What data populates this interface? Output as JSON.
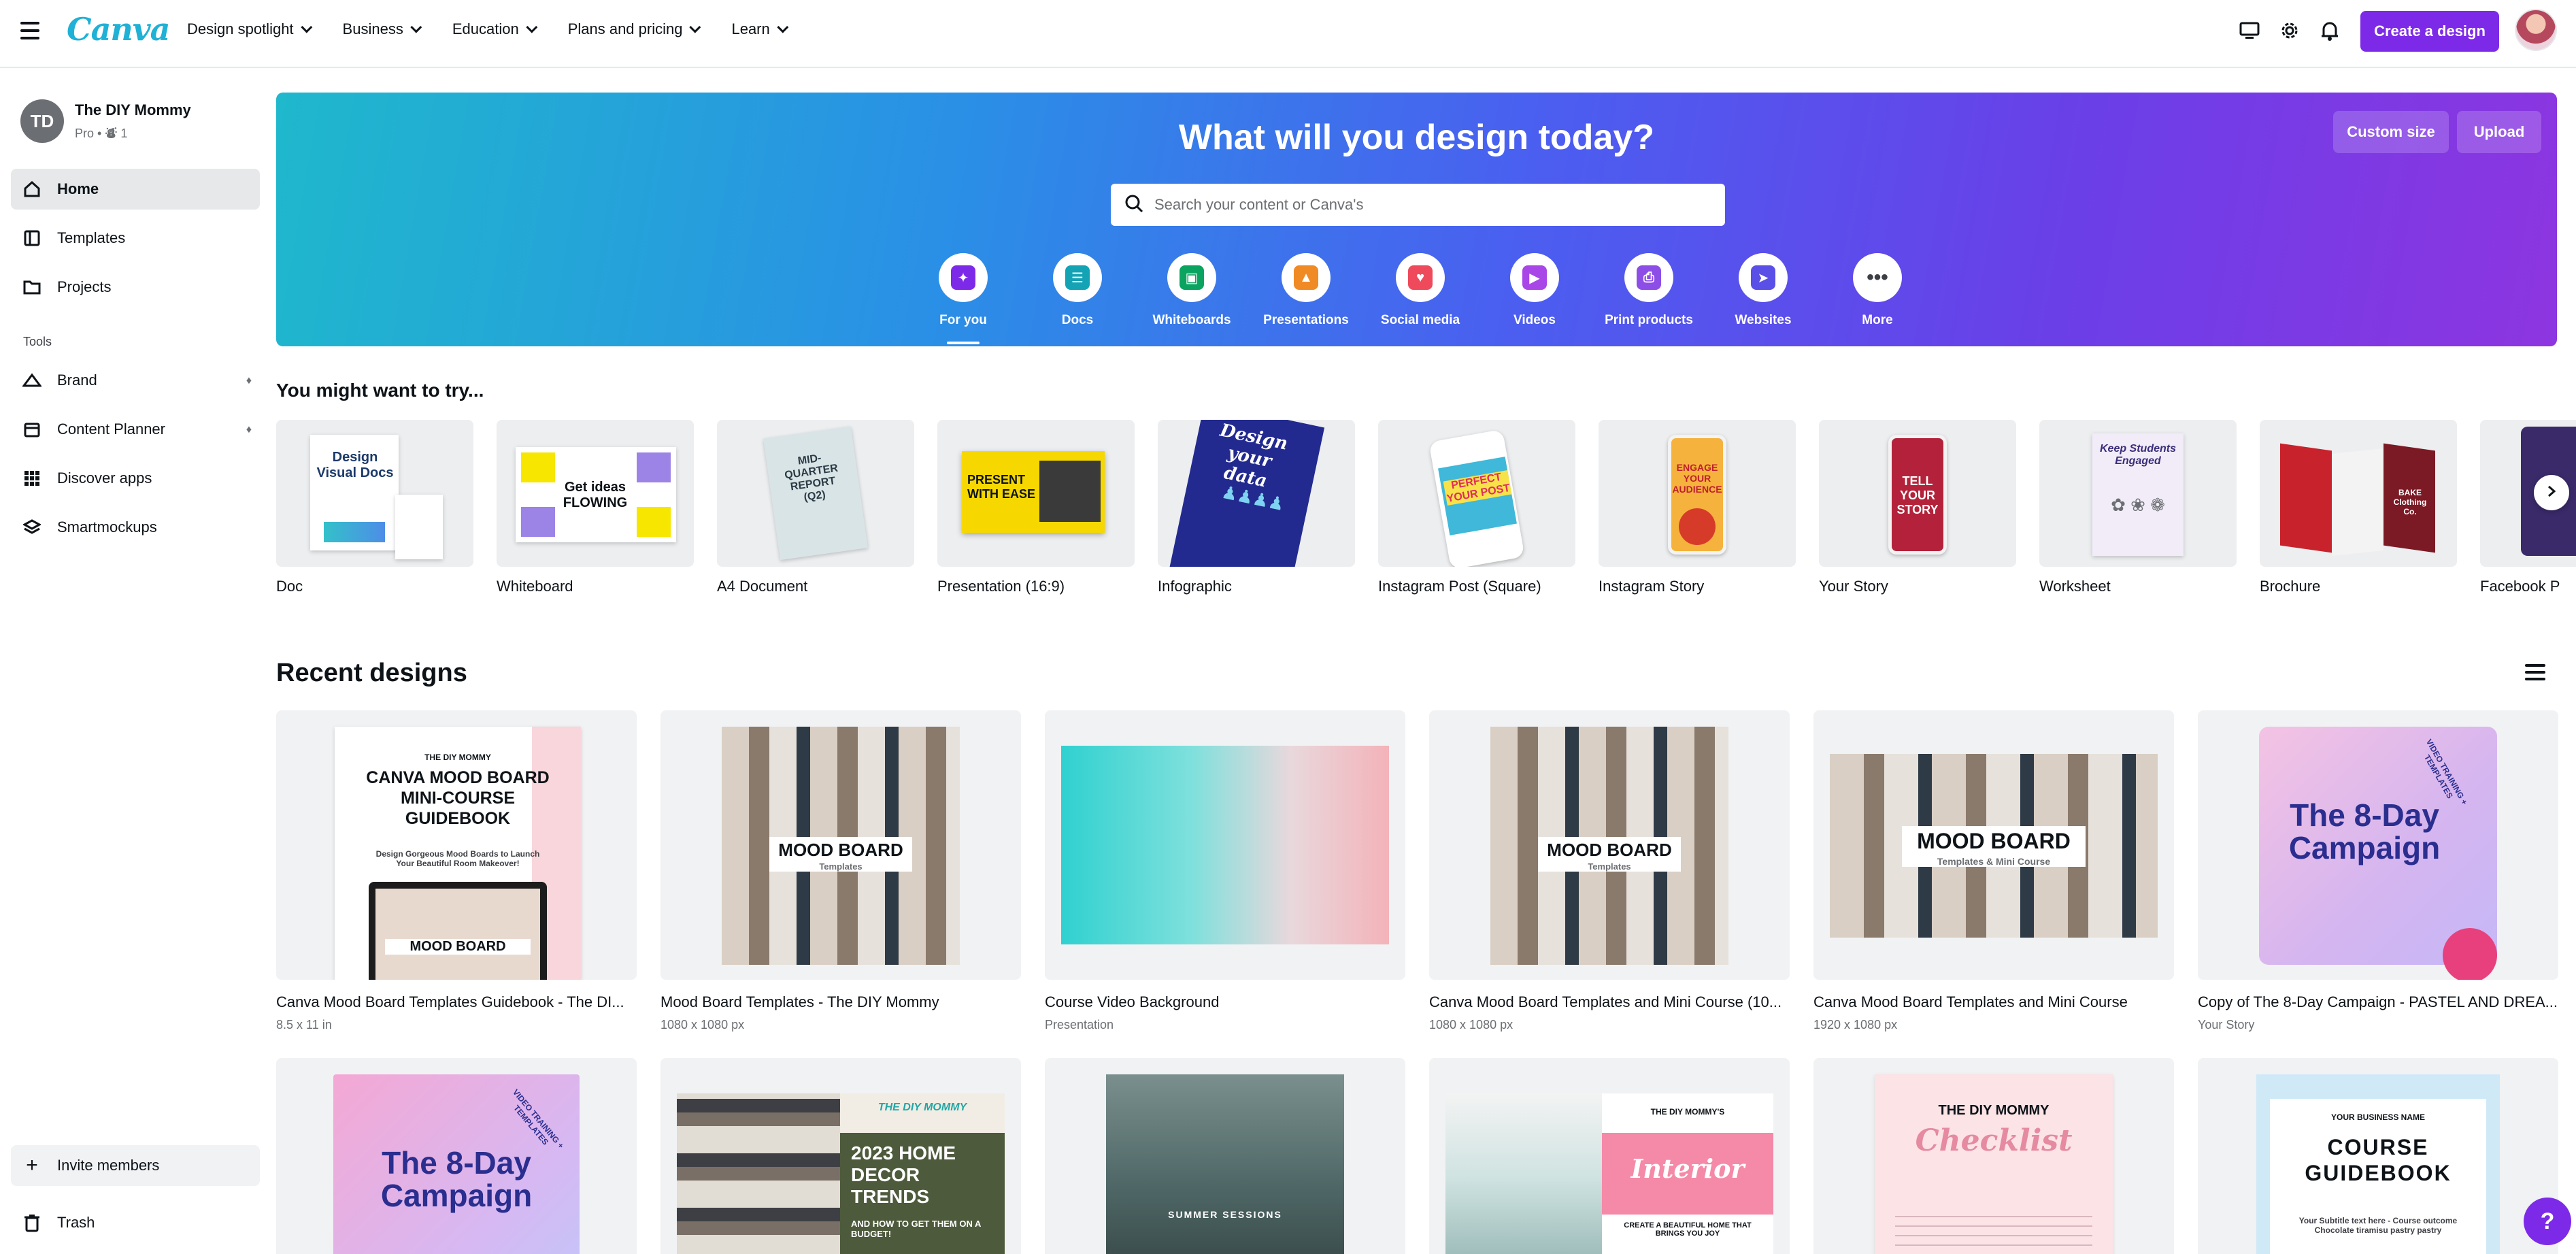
{
  "topbar": {
    "logo": "Canva",
    "nav": [
      "Design spotlight",
      "Business",
      "Education",
      "Plans and pricing",
      "Learn"
    ],
    "create_button": "Create a design"
  },
  "sidebar": {
    "team_initials": "TD",
    "team_name": "The DIY Mommy",
    "team_sub": "Pro • ⛇ 1",
    "items": [
      "Home",
      "Templates",
      "Projects"
    ],
    "tools_label": "Tools",
    "tools": [
      "Brand",
      "Content Planner",
      "Discover apps",
      "Smartmockups"
    ],
    "invite": "Invite members",
    "trash": "Trash"
  },
  "hero": {
    "title": "What will you design today?",
    "custom_size": "Custom size",
    "upload": "Upload",
    "search_placeholder": "Search your content or Canva's",
    "categories": [
      "For you",
      "Docs",
      "Whiteboards",
      "Presentations",
      "Social media",
      "Videos",
      "Print products",
      "Websites",
      "More"
    ],
    "category_colors": [
      "#7d2ae8",
      "#13a3b5",
      "#0ba360",
      "#f08a24",
      "#ef4a5b",
      "#a946e8",
      "#8c4ee6",
      "#5a4fe6",
      "#3d3f44"
    ]
  },
  "try_section": {
    "title": "You might want to try...",
    "items": [
      "Doc",
      "Whiteboard",
      "A4 Document",
      "Presentation (16:9)",
      "Infographic",
      "Instagram Post (Square)",
      "Instagram Story",
      "Your Story",
      "Worksheet",
      "Brochure",
      "Facebook P"
    ]
  },
  "thumb_text": {
    "doc": "Design Visual Docs",
    "whiteboard": "Get ideas FLOWING",
    "a4": "MID-QUARTER REPORT (Q2)",
    "presentation": "PRESENT WITH EASE",
    "infographic": "Design your data",
    "instagram_post": "PERFECT YOUR POST",
    "instagram_story": "ENGAGE YOUR AUDIENCE",
    "your_story": "TELL YOUR STORY",
    "worksheet": "Keep Students Engaged",
    "brochure": "BAKE Clothing Co."
  },
  "recent": {
    "title": "Recent designs",
    "designs": [
      {
        "title": "Canva Mood Board Templates Guidebook - The DI...",
        "meta": "8.5 x 11 in"
      },
      {
        "title": "Mood Board Templates - The DIY Mommy",
        "meta": "1080 x 1080 px"
      },
      {
        "title": "Course Video Background",
        "meta": "Presentation"
      },
      {
        "title": "Canva Mood Board Templates and Mini Course (10...",
        "meta": "1080 x 1080 px"
      },
      {
        "title": "Canva Mood Board Templates and Mini Course",
        "meta": "1920 x 1080 px"
      },
      {
        "title": "Copy of The 8-Day Campaign - PASTEL AND DREA...",
        "meta": "Your Story"
      }
    ],
    "thumb_text": {
      "guidebook_brand": "THE DIY MOMMY",
      "guidebook_title": "CANVA MOOD BOARD MINI-COURSE GUIDEBOOK",
      "guidebook_sub": "Design Gorgeous Mood Boards to Launch Your Beautiful Room Makeover!",
      "mood_board": "MOOD BOARD",
      "mood_board_sub": "Templates",
      "mood_board_sub2": "Templates & Mini Course",
      "campaign": "The 8-Day Campaign",
      "campaign_arc": "VIDEO TRAINING + TEMPLATES",
      "decor_brand": "THE DIY MOMMY",
      "decor_title": "2023 HOME DECOR TRENDS",
      "decor_sub": "AND HOW TO GET THEM ON A BUDGET!",
      "summer": "SUMMER SESSIONS",
      "interior_brand": "THE DIY MOMMY'S",
      "interior_title": "Interior",
      "interior_sub": "CREATE A BEAUTIFUL HOME THAT BRINGS YOU JOY",
      "checklist_brand": "THE DIY MOMMY",
      "checklist_title": "Checklist",
      "course_brand": "YOUR BUSINESS NAME",
      "course_title": "COURSE GUIDEBOOK",
      "course_sub": "Your Subtitle text here - Course outcome Chocolate tiramisu pastry pastry"
    }
  },
  "help": "?"
}
